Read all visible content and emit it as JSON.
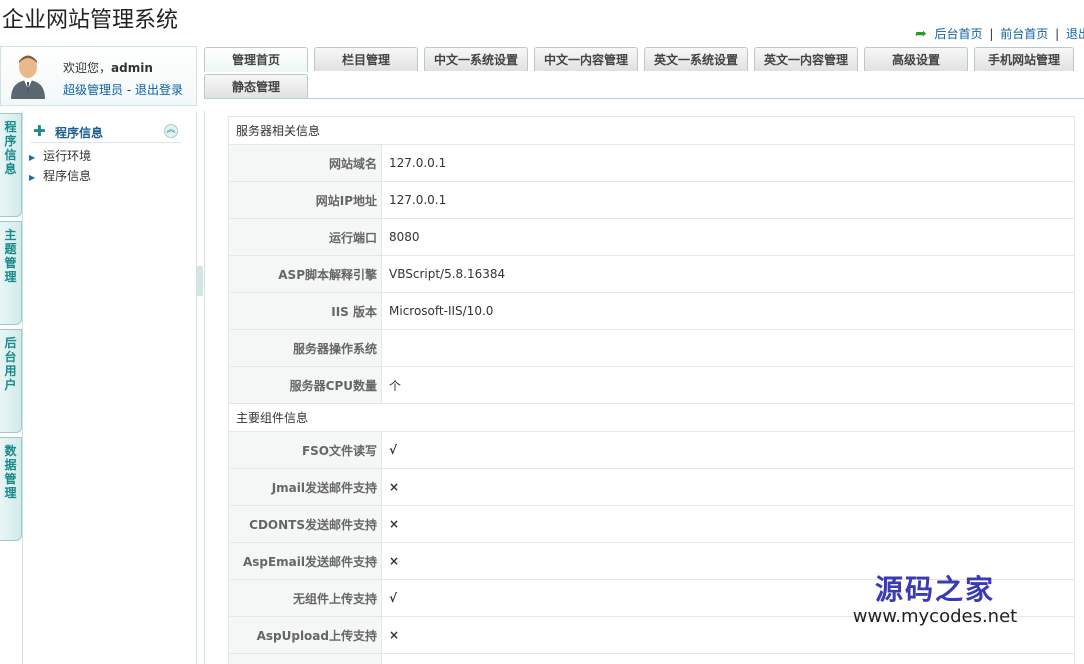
{
  "app": {
    "title": "企业网站管理系统"
  },
  "top_links": {
    "backend_home": "后台首页",
    "frontend_home": "前台首页",
    "logout": "退出"
  },
  "user": {
    "welcome_prefix": "欢迎您，",
    "username": "admin",
    "role": "超级管理员",
    "dash": "-",
    "logout": "退出登录"
  },
  "tabs": [
    "管理首页",
    "栏目管理",
    "中文一系统设置",
    "中文一内容管理",
    "英文一系统设置",
    "英文一内容管理",
    "高级设置",
    "手机网站管理",
    "静态管理"
  ],
  "vnav": [
    "程序信息",
    "主题管理",
    "后台用户",
    "数据管理"
  ],
  "sidebar": {
    "title": "程序信息",
    "items": [
      "运行环境",
      "程序信息"
    ]
  },
  "server_section": {
    "title": "服务器相关信息",
    "rows": [
      {
        "label": "网站域名",
        "value": "127.0.0.1"
      },
      {
        "label": "网站IP地址",
        "value": "127.0.0.1"
      },
      {
        "label": "运行端口",
        "value": "8080"
      },
      {
        "label": "ASP脚本解释引擎",
        "value": "VBScript/5.8.16384"
      },
      {
        "label": "IIS 版本",
        "value": "Microsoft-IIS/10.0"
      },
      {
        "label": "服务器操作系统",
        "value": ""
      },
      {
        "label": "服务器CPU数量",
        "value": "个"
      }
    ]
  },
  "component_section": {
    "title": "主要组件信息",
    "rows": [
      {
        "label": "FSO文件读写",
        "value": "√",
        "ok": true
      },
      {
        "label": "Jmail发送邮件支持",
        "value": "×",
        "ok": false
      },
      {
        "label": "CDONTS发送邮件支持",
        "value": "×",
        "ok": false
      },
      {
        "label": "AspEmail发送邮件支持",
        "value": "×",
        "ok": false
      },
      {
        "label": "无组件上传支持",
        "value": "√",
        "ok": true
      },
      {
        "label": "AspUpload上传支持",
        "value": "×",
        "ok": false
      }
    ]
  },
  "watermark": {
    "cn": "源码之家",
    "url": "www.mycodes.net"
  },
  "colors": {
    "accent": "#1a8a8a",
    "link": "#0b61a4",
    "yes": "#2a9b2a",
    "no": "#dd1111"
  }
}
